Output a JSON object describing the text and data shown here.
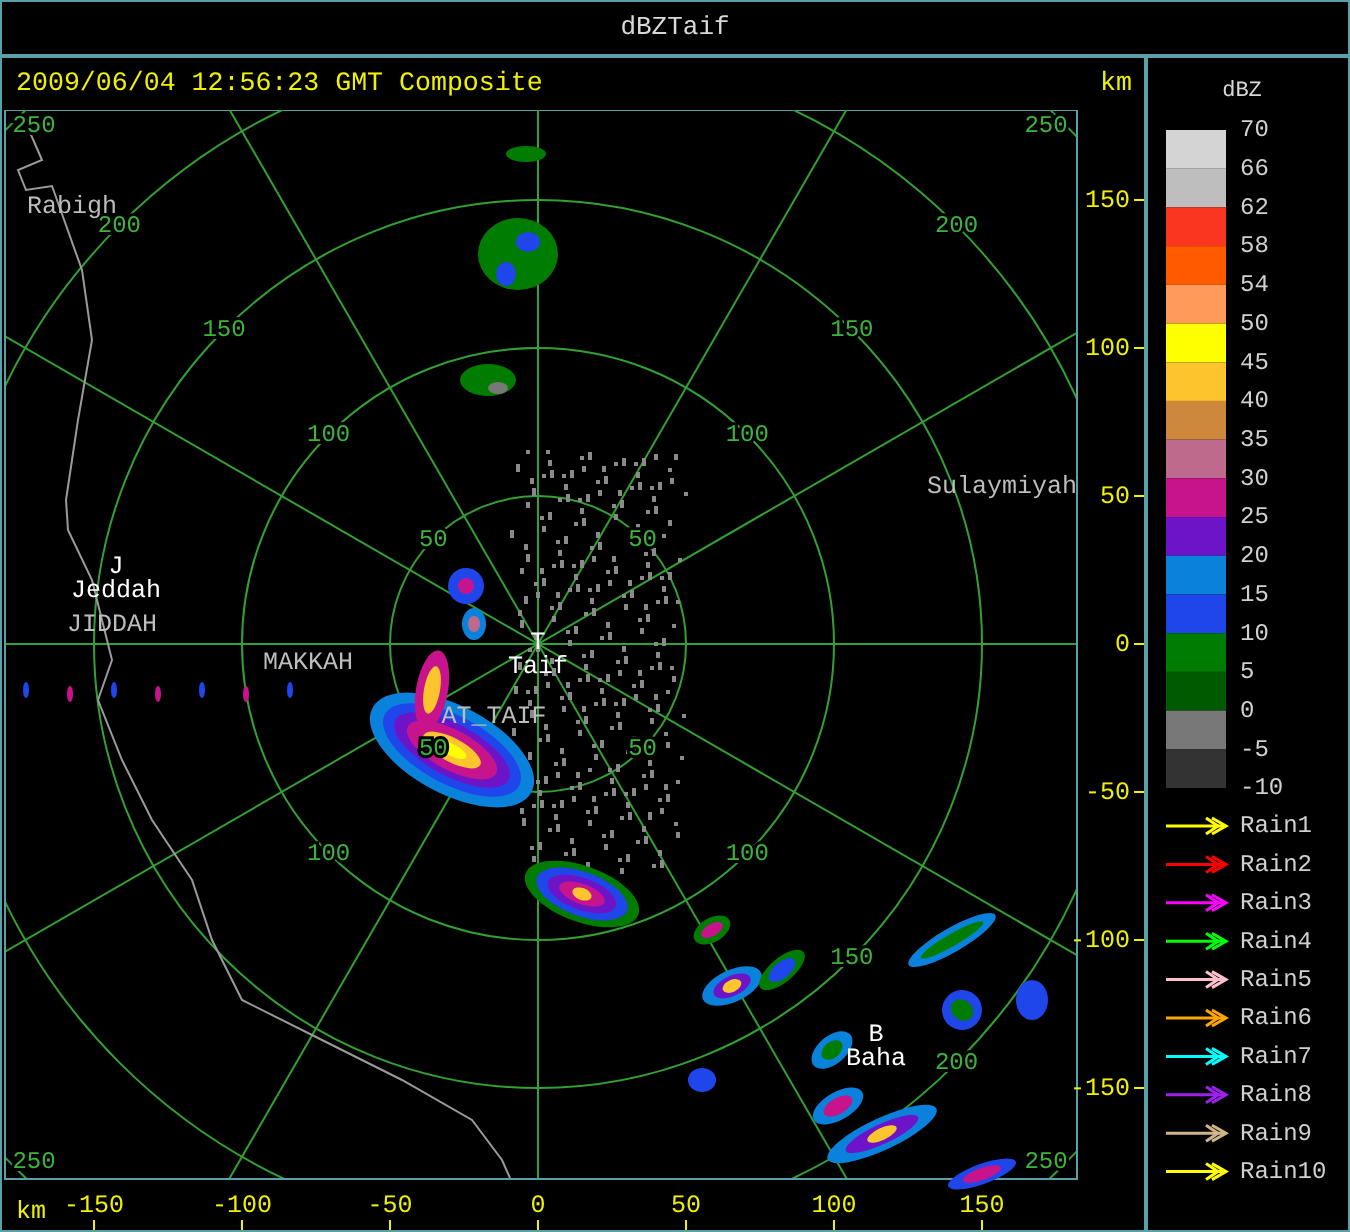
{
  "window": {
    "title": "dBZTaif"
  },
  "header": {
    "title": "2009/06/04 12:56:23 GMT Composite",
    "unit": "km"
  },
  "range_rings": [
    {
      "nw": "50",
      "ne": "50",
      "sw": "50",
      "se": "50"
    },
    {
      "nw": "100",
      "ne": "100",
      "sw": "100",
      "se": "100"
    },
    {
      "nw": "150",
      "ne": "150",
      "se": "150"
    },
    {
      "nw": "200",
      "ne": "200",
      "se": "200"
    },
    {
      "nw": "250",
      "ne": "250",
      "sw": "250",
      "se": "250"
    }
  ],
  "places": [
    {
      "kind": "town",
      "label": "Rabigh"
    },
    {
      "kind": "station",
      "marker": "J",
      "label": "Jeddah"
    },
    {
      "kind": "town",
      "label": "JIDDAH"
    },
    {
      "kind": "town",
      "label": "MAKKAH"
    },
    {
      "kind": "station",
      "marker": "T",
      "label": "Taif"
    },
    {
      "kind": "town",
      "label": "AT_TAIF"
    },
    {
      "kind": "town",
      "label": "Sulaymiyah"
    },
    {
      "kind": "station",
      "marker": "B",
      "label": "Baha"
    }
  ],
  "x_axis": {
    "label": "km",
    "ticks": [
      "-150",
      "-100",
      "-50",
      "0",
      "50",
      "100",
      "150"
    ]
  },
  "y_axis": {
    "ticks": [
      "150",
      "100",
      "50",
      "0",
      "-50",
      "-100",
      "-150"
    ]
  },
  "legend": {
    "unit": "dBZ",
    "swatches": [
      {
        "color": "#d4d4d4"
      },
      {
        "color": "#bebebe"
      },
      {
        "color": "#fa3520"
      },
      {
        "color": "#ff5a00"
      },
      {
        "color": "#ff9a5a"
      },
      {
        "color": "#ffff00"
      },
      {
        "color": "#fcc42d"
      },
      {
        "color": "#ce883c"
      },
      {
        "color": "#be6a8c"
      },
      {
        "color": "#c8148c"
      },
      {
        "color": "#6e14c8"
      },
      {
        "color": "#0a82dc"
      },
      {
        "color": "#1e46eb"
      },
      {
        "color": "#007d00"
      },
      {
        "color": "#005a00"
      },
      {
        "color": "#787878"
      },
      {
        "color": "#333333"
      }
    ],
    "labels": [
      "70",
      "66",
      "62",
      "58",
      "54",
      "50",
      "45",
      "40",
      "35",
      "30",
      "25",
      "20",
      "15",
      "10",
      "5",
      "0",
      "-5",
      "-10"
    ]
  },
  "tracks": [
    {
      "name": "Rain1",
      "color": "#ffff00"
    },
    {
      "name": "Rain2",
      "color": "#ff0000"
    },
    {
      "name": "Rain3",
      "color": "#ff00ff"
    },
    {
      "name": "Rain4",
      "color": "#00ff00"
    },
    {
      "name": "Rain5",
      "color": "#ffc0cb"
    },
    {
      "name": "Rain6",
      "color": "#ffa500"
    },
    {
      "name": "Rain7",
      "color": "#00ffff"
    },
    {
      "name": "Rain8",
      "color": "#a020f0"
    },
    {
      "name": "Rain9",
      "color": "#d2b48c"
    },
    {
      "name": "Rain10",
      "color": "#ffff00"
    }
  ]
}
